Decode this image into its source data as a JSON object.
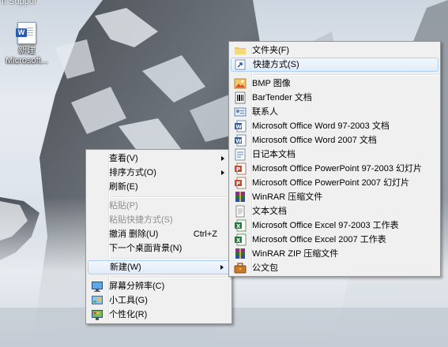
{
  "desktop": {
    "top_label": "ft Suppor",
    "icon": {
      "label_line1": "新建",
      "label_line2": "Microsoft...",
      "icon_glyph": "W"
    }
  },
  "context_menu": {
    "items": [
      {
        "label": "查看(V)",
        "arrow": true
      },
      {
        "label": "排序方式(O)",
        "arrow": true
      },
      {
        "label": "刷新(E)"
      },
      {
        "label": "粘贴(P)",
        "disabled": true
      },
      {
        "label": "粘贴快捷方式(S)",
        "disabled": true
      },
      {
        "label": "撤消 删除(U)",
        "shortcut": "Ctrl+Z"
      },
      {
        "label": "下一个桌面背景(N)"
      },
      {
        "label": "新建(W)",
        "arrow": true,
        "highlighted": true
      },
      {
        "label": "屏幕分辨率(C)",
        "icon": "monitor-icon"
      },
      {
        "label": "小工具(G)",
        "icon": "gadgets-icon"
      },
      {
        "label": "个性化(R)",
        "icon": "personalize-icon"
      }
    ]
  },
  "new_submenu": {
    "items": [
      {
        "label": "文件夹(F)",
        "icon": "folder-icon"
      },
      {
        "label": "快捷方式(S)",
        "icon": "shortcut-icon",
        "highlighted": true
      },
      {
        "label": "BMP 图像",
        "icon": "bmp-image-icon"
      },
      {
        "label": "BarTender 文档",
        "icon": "bartender-icon"
      },
      {
        "label": "联系人",
        "icon": "contact-icon"
      },
      {
        "label": "Microsoft Office Word 97-2003 文档",
        "icon": "word-icon"
      },
      {
        "label": "Microsoft Office Word 2007 文档",
        "icon": "word-icon"
      },
      {
        "label": "日记本文档",
        "icon": "journal-icon"
      },
      {
        "label": "Microsoft Office PowerPoint 97-2003 幻灯片",
        "icon": "powerpoint-icon"
      },
      {
        "label": "Microsoft Office PowerPoint 2007 幻灯片",
        "icon": "powerpoint-icon"
      },
      {
        "label": "WinRAR 压缩文件",
        "icon": "winrar-icon"
      },
      {
        "label": "文本文档",
        "icon": "text-document-icon"
      },
      {
        "label": "Microsoft Office Excel 97-2003 工作表",
        "icon": "excel-icon"
      },
      {
        "label": "Microsoft Office Excel 2007 工作表",
        "icon": "excel-icon"
      },
      {
        "label": "WinRAR ZIP 压缩文件",
        "icon": "winrar-zip-icon"
      },
      {
        "label": "公文包",
        "icon": "briefcase-icon"
      }
    ]
  },
  "colors": {
    "menu_bg": "#f0f0f0",
    "menu_border": "#979797",
    "highlight_border": "#aecff7",
    "disabled_text": "#8d8d8d"
  }
}
